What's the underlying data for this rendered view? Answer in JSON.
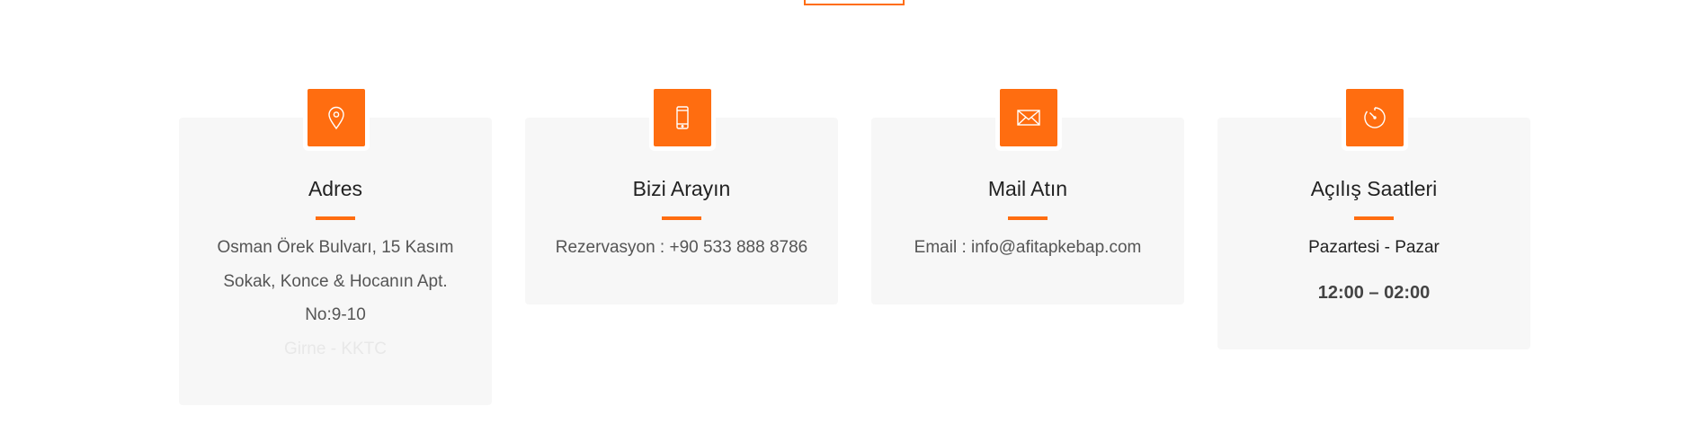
{
  "cards": [
    {
      "title": "Adres",
      "icon": "location-pin-icon",
      "lines": [
        "Osman Örek Bulvarı, 15 Kasım",
        "Sokak, Konce & Hocanın Apt.",
        "No:9-10",
        "Girne - KKTC"
      ]
    },
    {
      "title": "Bizi Arayın",
      "icon": "mobile-phone-icon",
      "lines": [
        "Rezervasyon : +90 533 888 8786"
      ]
    },
    {
      "title": "Mail Atın",
      "icon": "envelope-icon",
      "lines": [
        "Email : info@afitapkebap.com"
      ]
    },
    {
      "title": "Açılış Saatleri",
      "icon": "timer-icon",
      "days": "Pazartesi - Pazar",
      "hours": "12:00 – 02:00"
    }
  ],
  "colors": {
    "accent": "#ff6d10",
    "card_bg": "#f7f7f7",
    "title": "#222222",
    "text": "#555555"
  }
}
